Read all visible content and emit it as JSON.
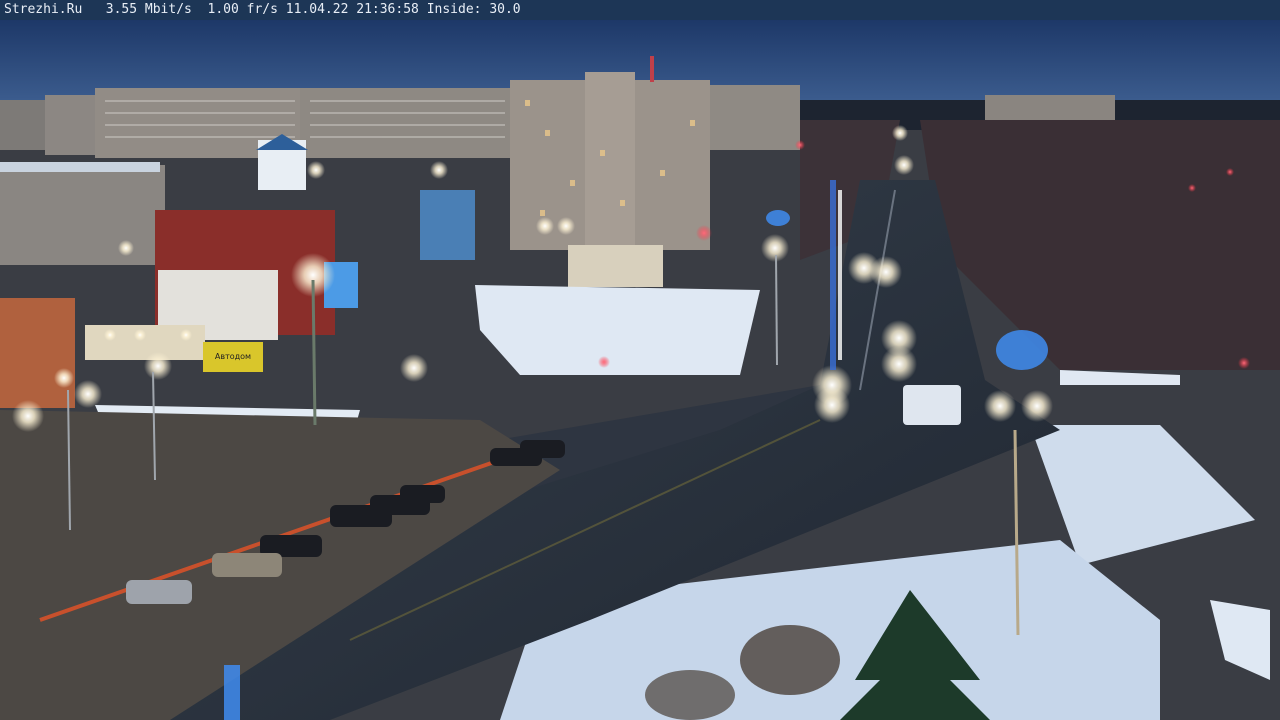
{
  "overlay": {
    "site": "Strezhi.Ru",
    "bitrate": "3.55 Mbit/s",
    "framerate": "1.00 fr/s",
    "date": "11.04.22",
    "time": "21:36:58",
    "inside": "Inside: 30.0"
  },
  "signs": {
    "shop_sign": "Автодом"
  },
  "palette": {
    "sky_top": "#1f3a66",
    "sky_bottom": "#3e5f8c",
    "snow": "#d6e2f0",
    "road": "#2b3340",
    "lamp": "#fff4d6",
    "building": "#8e8a85"
  }
}
